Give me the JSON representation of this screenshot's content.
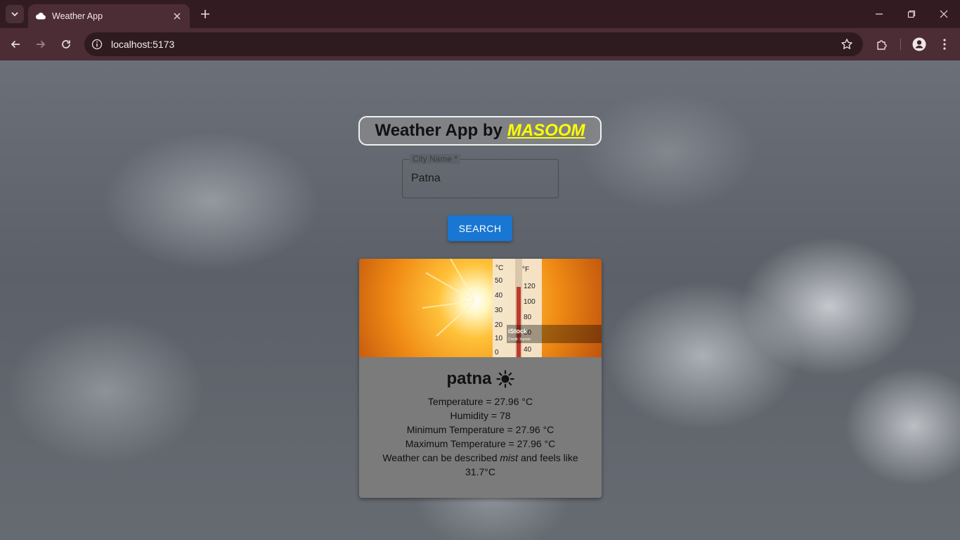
{
  "browser": {
    "tab_title": "Weather App",
    "url": "localhost:5173"
  },
  "page": {
    "heading_prefix": "Weather App by",
    "heading_name": "MASOOM",
    "city_field_label": "City Name *",
    "city_field_value": "Patna",
    "search_button": "SEARCH",
    "image_watermark": "iStock",
    "image_credit": "Credit: Xurzon",
    "thermometer_scale": {
      "celsius_label": "°C",
      "fahrenheit_label": "°F",
      "celsius_ticks": [
        "50",
        "40",
        "30",
        "20",
        "10",
        "0"
      ],
      "fahrenheit_ticks": [
        "120",
        "100",
        "80",
        "60",
        "40"
      ]
    }
  },
  "weather": {
    "city": "patna",
    "icon": "sun-icon",
    "temperature_line": "Temperature = 27.96 °C",
    "humidity_line": "Humidity = 78",
    "min_temp_line": "Minimum Temperature = 27.96 °C",
    "max_temp_line": "Maximum Temperature = 27.96 °C",
    "desc_prefix": "Weather can be described",
    "desc_condition": "mist",
    "desc_suffix": "and feels like 31.7°C"
  },
  "colors": {
    "button_blue": "#1976d2",
    "brand_yellow": "#ffff00",
    "chrome_dark": "#321c22",
    "chrome_toolbar": "#4c2d35"
  }
}
